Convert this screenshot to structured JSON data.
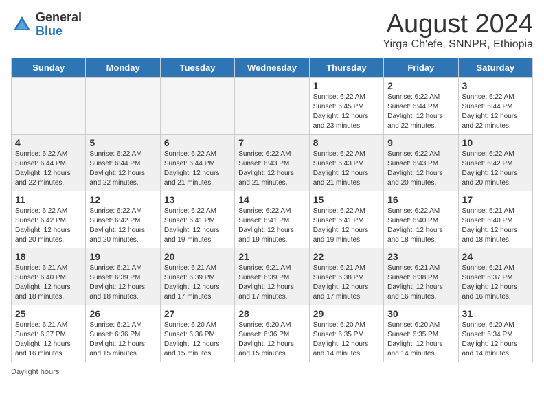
{
  "header": {
    "logo_general": "General",
    "logo_blue": "Blue",
    "month_title": "August 2024",
    "location": "Yirga Ch'efe, SNNPR, Ethiopia"
  },
  "days_of_week": [
    "Sunday",
    "Monday",
    "Tuesday",
    "Wednesday",
    "Thursday",
    "Friday",
    "Saturday"
  ],
  "weeks": [
    [
      {
        "day": "",
        "detail": ""
      },
      {
        "day": "",
        "detail": ""
      },
      {
        "day": "",
        "detail": ""
      },
      {
        "day": "",
        "detail": ""
      },
      {
        "day": "1",
        "detail": "Sunrise: 6:22 AM\nSunset: 6:45 PM\nDaylight: 12 hours\nand 23 minutes."
      },
      {
        "day": "2",
        "detail": "Sunrise: 6:22 AM\nSunset: 6:44 PM\nDaylight: 12 hours\nand 22 minutes."
      },
      {
        "day": "3",
        "detail": "Sunrise: 6:22 AM\nSunset: 6:44 PM\nDaylight: 12 hours\nand 22 minutes."
      }
    ],
    [
      {
        "day": "4",
        "detail": "Sunrise: 6:22 AM\nSunset: 6:44 PM\nDaylight: 12 hours\nand 22 minutes."
      },
      {
        "day": "5",
        "detail": "Sunrise: 6:22 AM\nSunset: 6:44 PM\nDaylight: 12 hours\nand 22 minutes."
      },
      {
        "day": "6",
        "detail": "Sunrise: 6:22 AM\nSunset: 6:44 PM\nDaylight: 12 hours\nand 21 minutes."
      },
      {
        "day": "7",
        "detail": "Sunrise: 6:22 AM\nSunset: 6:43 PM\nDaylight: 12 hours\nand 21 minutes."
      },
      {
        "day": "8",
        "detail": "Sunrise: 6:22 AM\nSunset: 6:43 PM\nDaylight: 12 hours\nand 21 minutes."
      },
      {
        "day": "9",
        "detail": "Sunrise: 6:22 AM\nSunset: 6:43 PM\nDaylight: 12 hours\nand 20 minutes."
      },
      {
        "day": "10",
        "detail": "Sunrise: 6:22 AM\nSunset: 6:42 PM\nDaylight: 12 hours\nand 20 minutes."
      }
    ],
    [
      {
        "day": "11",
        "detail": "Sunrise: 6:22 AM\nSunset: 6:42 PM\nDaylight: 12 hours\nand 20 minutes."
      },
      {
        "day": "12",
        "detail": "Sunrise: 6:22 AM\nSunset: 6:42 PM\nDaylight: 12 hours\nand 20 minutes."
      },
      {
        "day": "13",
        "detail": "Sunrise: 6:22 AM\nSunset: 6:41 PM\nDaylight: 12 hours\nand 19 minutes."
      },
      {
        "day": "14",
        "detail": "Sunrise: 6:22 AM\nSunset: 6:41 PM\nDaylight: 12 hours\nand 19 minutes."
      },
      {
        "day": "15",
        "detail": "Sunrise: 6:22 AM\nSunset: 6:41 PM\nDaylight: 12 hours\nand 19 minutes."
      },
      {
        "day": "16",
        "detail": "Sunrise: 6:22 AM\nSunset: 6:40 PM\nDaylight: 12 hours\nand 18 minutes."
      },
      {
        "day": "17",
        "detail": "Sunrise: 6:21 AM\nSunset: 6:40 PM\nDaylight: 12 hours\nand 18 minutes."
      }
    ],
    [
      {
        "day": "18",
        "detail": "Sunrise: 6:21 AM\nSunset: 6:40 PM\nDaylight: 12 hours\nand 18 minutes."
      },
      {
        "day": "19",
        "detail": "Sunrise: 6:21 AM\nSunset: 6:39 PM\nDaylight: 12 hours\nand 18 minutes."
      },
      {
        "day": "20",
        "detail": "Sunrise: 6:21 AM\nSunset: 6:39 PM\nDaylight: 12 hours\nand 17 minutes."
      },
      {
        "day": "21",
        "detail": "Sunrise: 6:21 AM\nSunset: 6:39 PM\nDaylight: 12 hours\nand 17 minutes."
      },
      {
        "day": "22",
        "detail": "Sunrise: 6:21 AM\nSunset: 6:38 PM\nDaylight: 12 hours\nand 17 minutes."
      },
      {
        "day": "23",
        "detail": "Sunrise: 6:21 AM\nSunset: 6:38 PM\nDaylight: 12 hours\nand 16 minutes."
      },
      {
        "day": "24",
        "detail": "Sunrise: 6:21 AM\nSunset: 6:37 PM\nDaylight: 12 hours\nand 16 minutes."
      }
    ],
    [
      {
        "day": "25",
        "detail": "Sunrise: 6:21 AM\nSunset: 6:37 PM\nDaylight: 12 hours\nand 16 minutes."
      },
      {
        "day": "26",
        "detail": "Sunrise: 6:21 AM\nSunset: 6:36 PM\nDaylight: 12 hours\nand 15 minutes."
      },
      {
        "day": "27",
        "detail": "Sunrise: 6:20 AM\nSunset: 6:36 PM\nDaylight: 12 hours\nand 15 minutes."
      },
      {
        "day": "28",
        "detail": "Sunrise: 6:20 AM\nSunset: 6:36 PM\nDaylight: 12 hours\nand 15 minutes."
      },
      {
        "day": "29",
        "detail": "Sunrise: 6:20 AM\nSunset: 6:35 PM\nDaylight: 12 hours\nand 14 minutes."
      },
      {
        "day": "30",
        "detail": "Sunrise: 6:20 AM\nSunset: 6:35 PM\nDaylight: 12 hours\nand 14 minutes."
      },
      {
        "day": "31",
        "detail": "Sunrise: 6:20 AM\nSunset: 6:34 PM\nDaylight: 12 hours\nand 14 minutes."
      }
    ]
  ],
  "footer": {
    "label": "Daylight hours"
  },
  "shaded_rows": [
    1,
    3
  ]
}
